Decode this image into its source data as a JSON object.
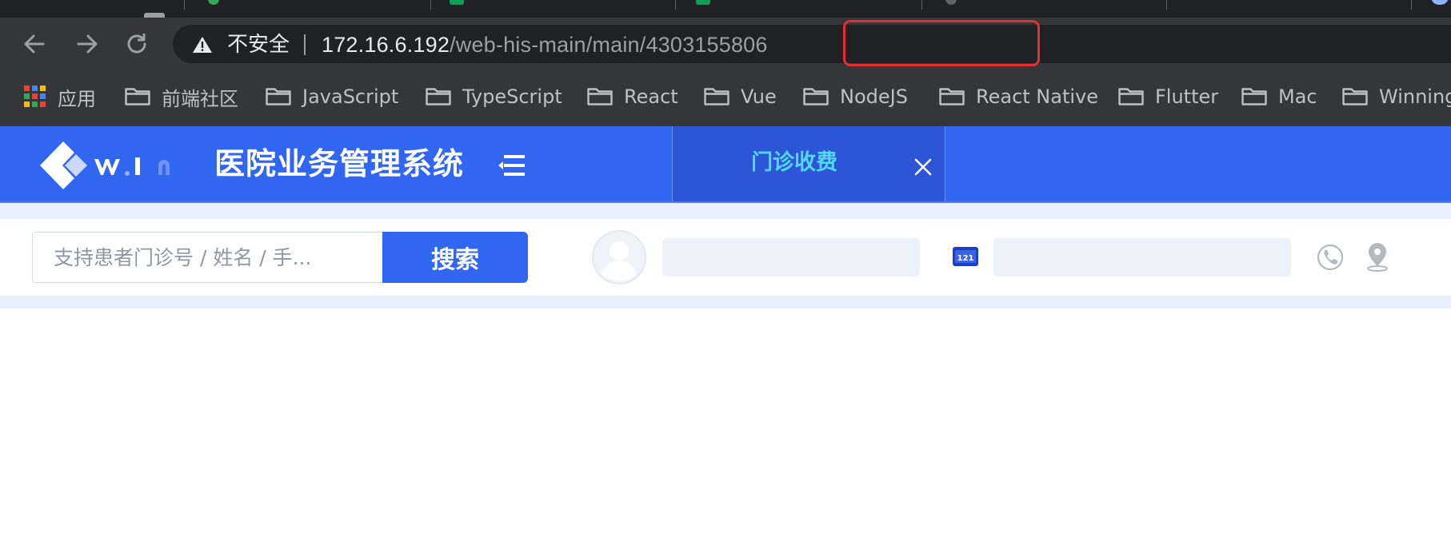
{
  "browser": {
    "security_label": "不安全",
    "url_host": "172.16.6.192",
    "url_path": "/web-his-main/main/",
    "url_id": "4303155806",
    "highlight_color": "#e3302f",
    "bookmarks": [
      {
        "label": "应用",
        "icon": "apps-grid-icon"
      },
      {
        "label": "前端社区",
        "icon": "folder-icon"
      },
      {
        "label": "JavaScript",
        "icon": "folder-icon"
      },
      {
        "label": "TypeScript",
        "icon": "folder-icon"
      },
      {
        "label": "React",
        "icon": "folder-icon"
      },
      {
        "label": "Vue",
        "icon": "folder-icon"
      },
      {
        "label": "NodeJS",
        "icon": "folder-icon"
      },
      {
        "label": "React Native",
        "icon": "folder-icon"
      },
      {
        "label": "Flutter",
        "icon": "folder-icon"
      },
      {
        "label": "Mac",
        "icon": "folder-icon"
      },
      {
        "label": "Winning",
        "icon": "folder-icon"
      }
    ]
  },
  "app": {
    "brand_color": "#3166f0",
    "title": "医院业务管理系统",
    "open_tab": {
      "label": "门诊收费",
      "color": "#52d8f0"
    }
  },
  "patient_bar": {
    "search_placeholder": "支持患者门诊号 / 姓名 / 手...",
    "search_button": "搜索",
    "card_icon_text": "121"
  }
}
